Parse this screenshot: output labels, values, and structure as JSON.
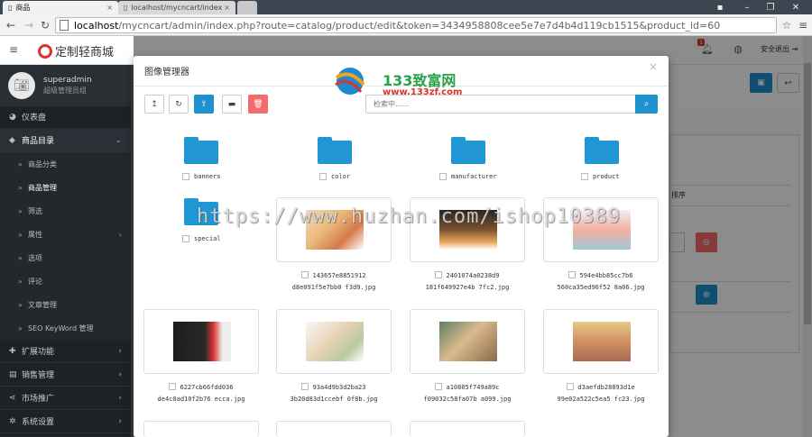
{
  "browser": {
    "tabs": [
      {
        "title": "商品"
      },
      {
        "title": "localhost/mycncart/index"
      }
    ],
    "url_host": "localhost",
    "url_rest": "/mycncart/admin/index.php?route=catalog/product/edit&token=3434958808cee5e7e7d4b4d119cb1515&product_id=60"
  },
  "header": {
    "logo_text": "定制轻商城",
    "notification_count": "1",
    "logout_label": "安全退出"
  },
  "sidebar": {
    "username": "superadmin",
    "role": "超级管理员组",
    "items": [
      {
        "label": "仪表盘",
        "icon": "dashboard-icon",
        "type": "menu"
      },
      {
        "label": "商品目录",
        "icon": "tag-icon",
        "type": "menu",
        "active": true,
        "expanded": true
      },
      {
        "label": "商品分类",
        "type": "sub"
      },
      {
        "label": "商品管理",
        "type": "sub",
        "active": true
      },
      {
        "label": "筛选",
        "type": "sub"
      },
      {
        "label": "属性",
        "type": "sub",
        "has_children": true
      },
      {
        "label": "选项",
        "type": "sub"
      },
      {
        "label": "评论",
        "type": "sub"
      },
      {
        "label": "文章管理",
        "type": "sub"
      },
      {
        "label": "SEO KeyWord 管理",
        "type": "sub"
      },
      {
        "label": "扩展功能",
        "icon": "puzzle-icon",
        "type": "menu",
        "has_children": true
      },
      {
        "label": "销售管理",
        "icon": "cart-icon",
        "type": "menu",
        "has_children": true
      },
      {
        "label": "市场推广",
        "icon": "share-icon",
        "type": "menu",
        "has_children": true
      },
      {
        "label": "系统设置",
        "icon": "cog-icon",
        "type": "menu",
        "has_children": true
      }
    ]
  },
  "page": {
    "sort_label": "排序"
  },
  "modal": {
    "title": "图像管理器",
    "search_placeholder": "检索中......",
    "folders": [
      "banners",
      "color",
      "manufacturer",
      "product",
      "special"
    ],
    "images": [
      {
        "line1": "143657e8851912",
        "line2": "d8e091f5e7bb0 f3d9.jpg"
      },
      {
        "line1": "2401074a0238d9",
        "line2": "181f649927e4b 7fc2.jpg"
      },
      {
        "line1": "594e4bb85cc7b6",
        "line2": "560ca35ed96f52 8a06.jpg"
      },
      {
        "line1": "6227cb66fdd036",
        "line2": "de4c0ad10f2b76 ecca.jpg"
      },
      {
        "line1": "93a4d9b3d2ba23",
        "line2": "3b20d83d1ccebf 0f8b.jpg"
      },
      {
        "line1": "a10805f749a89c",
        "line2": "f09032c58fa07b a099.jpg"
      },
      {
        "line1": "d3aefdb28893d1e",
        "line2": "99e02a522c5ea5 fc23.jpg"
      }
    ]
  },
  "watermark": {
    "brand_title": "133致富网",
    "brand_url": "www.133zf.com",
    "overlay_url": "https://www.huzhan.com/ishop10389"
  },
  "colors": {
    "primary": "#1e91cf",
    "danger": "#f56b6b",
    "folder": "#2196d4",
    "sidebar": "#1e2226",
    "brand_red": "#d9352a"
  }
}
